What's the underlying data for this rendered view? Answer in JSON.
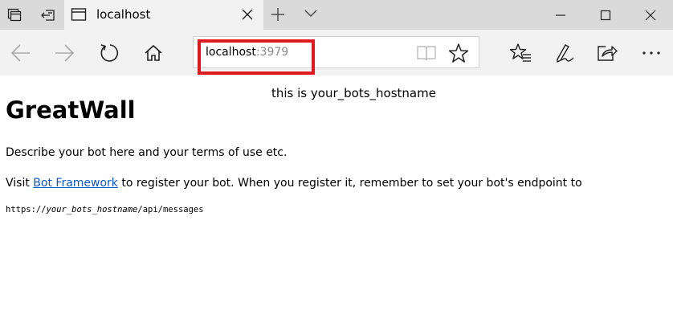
{
  "browser": {
    "tab": {
      "title": "localhost"
    },
    "address": {
      "host": "localhost",
      "port": ":3979"
    }
  },
  "page": {
    "note": "this is your_bots_hostname",
    "title": "GreatWall",
    "description": "Describe your bot here and your terms of use etc.",
    "visit_prefix": "Visit ",
    "visit_link": "Bot Framework",
    "visit_suffix": " to register your bot. When you register it, remember to set your bot's endpoint to",
    "endpoint_prefix": "https://",
    "endpoint_host": "your_bots_hostname",
    "endpoint_path": "/api/messages"
  },
  "colors": {
    "titlebar_bg": "#dadada",
    "toolbar_bg": "#f2f2f2",
    "highlight_border": "#e0191f",
    "link": "#0b57c4"
  },
  "icons": {
    "tab_manager": "tab-manager-icon",
    "set_aside": "set-aside-tabs-icon",
    "tab_page": "page-icon",
    "tab_close": "close-icon",
    "new_tab": "plus-icon",
    "tab_preview": "chevron-down-icon",
    "back": "back-arrow-icon",
    "forward": "forward-arrow-icon",
    "refresh": "refresh-icon",
    "home": "home-icon",
    "reading_view": "book-icon",
    "favorite": "star-icon",
    "favorites_hub": "favorites-list-icon",
    "notes": "pen-icon",
    "share": "share-icon",
    "more": "more-icon",
    "minimize": "minimize-icon",
    "maximize": "maximize-icon",
    "close_window": "close-window-icon"
  }
}
